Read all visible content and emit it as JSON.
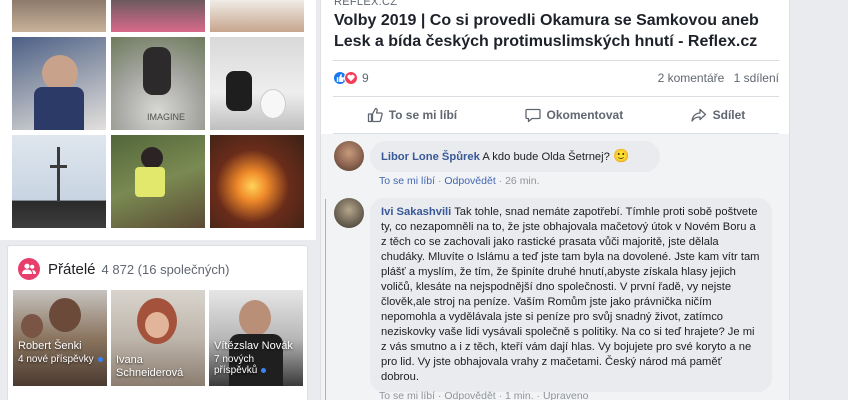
{
  "post": {
    "source": "REFLEX.CZ",
    "headline": "Volby 2019 | Co si provedli Okamura se Samkovou aneb Lesk a bída českých protimuslimských hnutí - Reflex.cz",
    "reaction_count": "9",
    "comments": "2 komentáře",
    "shares": "1 sdílení",
    "actions": {
      "like": "To se mi líbí",
      "comment": "Okomentovat",
      "share": "Sdílet"
    }
  },
  "comments": [
    {
      "author": "Libor Lone Špůrek",
      "text": "A kdo bude Olda Šetrnej?",
      "emoji": "🙂",
      "like": "To se mi líbí",
      "reply": "Odpovědět",
      "time": "26 min."
    },
    {
      "author": "Ivi Sakashvili",
      "text": "Tak tohle, snad nemáte zapotřebí. Tímhle proti sobě poštvete ty, co nezapomněli na to, že jste obhajovala mačetový útok v Novém Boru a z těch co se zachovali jako rastické prasata vůči majoritě, jste dělala chudáky. Mluvíte o Islámu a teď jste tam byla na dovolené. Jste kam vítr tam plášť a myslím, že tím, že špiníte druhé hnutí,abyste získala hlasy jejich voličů, klesáte na nejspodnější dno společnosti. V první řadě, vy nejste člověk,ale stroj na peníze. Vaším Romům jste jako právnička ničím nepomohla a vydělávala jste si peníze pro svůj snadný život, zatímco neziskovky vaše lidi vysávali společně s politiky. Na co si teď hrajete? Je mi z vás smutno a i z těch, kteří vám dají hlas. Vy bojujete pro své koryto a ne pro lid. Vy jste obhajovala vrahy z mačetami. Český národ má paměť dobrou.",
      "meta_partial": "To se mi líbí · Odpovědět · 1 min. · Upraveno"
    }
  ],
  "friends": {
    "title": "Přátelé",
    "count": "4 872 (16 společných)",
    "tiles": [
      {
        "name": "Robert Šenki",
        "sub": "4 nové příspěvky"
      },
      {
        "name": "Ivana Schneiderová",
        "sub": ""
      },
      {
        "name": "Vítězslav Novák",
        "sub": "7 nových příspěvků"
      }
    ]
  },
  "photos": [
    {
      "label": ""
    },
    {
      "label": ""
    },
    {
      "label": ""
    },
    {
      "label": ""
    },
    {
      "label": "IMAGINE"
    },
    {
      "label": ""
    },
    {
      "label": ""
    },
    {
      "label": ""
    },
    {
      "label": ""
    }
  ],
  "colors": {
    "link": "#385898",
    "like_blue": "#1877f2",
    "love_red": "#f33e58",
    "friends_pink": "#e83e6c"
  }
}
